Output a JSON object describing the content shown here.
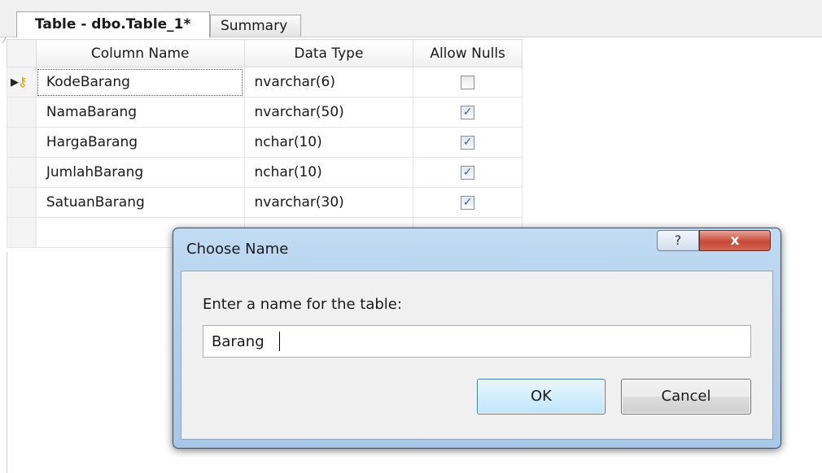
{
  "tabs": [
    {
      "label": "Table - dbo.Table_1*",
      "active": true
    },
    {
      "label": "Summary",
      "active": false
    }
  ],
  "grid": {
    "headers": [
      "Column Name",
      "Data Type",
      "Allow Nulls"
    ],
    "rows": [
      {
        "name": "KodeBarang",
        "type": "nvarchar(6)",
        "allow_nulls": false,
        "primary_key": true
      },
      {
        "name": "NamaBarang",
        "type": "nvarchar(50)",
        "allow_nulls": true
      },
      {
        "name": "HargaBarang",
        "type": "nchar(10)",
        "allow_nulls": true
      },
      {
        "name": "JumlahBarang",
        "type": "nchar(10)",
        "allow_nulls": true
      },
      {
        "name": "SatuanBarang",
        "type": "nvarchar(30)",
        "allow_nulls": true
      }
    ],
    "row_icons": [
      "arrow-right-icon",
      "key-icon"
    ]
  },
  "dialog": {
    "title": "Choose Name",
    "help_label": "?",
    "close_label": "x",
    "prompt": "Enter a name for the table:",
    "input_value": "Barang",
    "ok_label": "OK",
    "cancel_label": "Cancel"
  },
  "colors": {
    "dialog_frame": "#b3cfec",
    "close_button": "#c84a38",
    "ok_border": "#3c7fb1"
  }
}
